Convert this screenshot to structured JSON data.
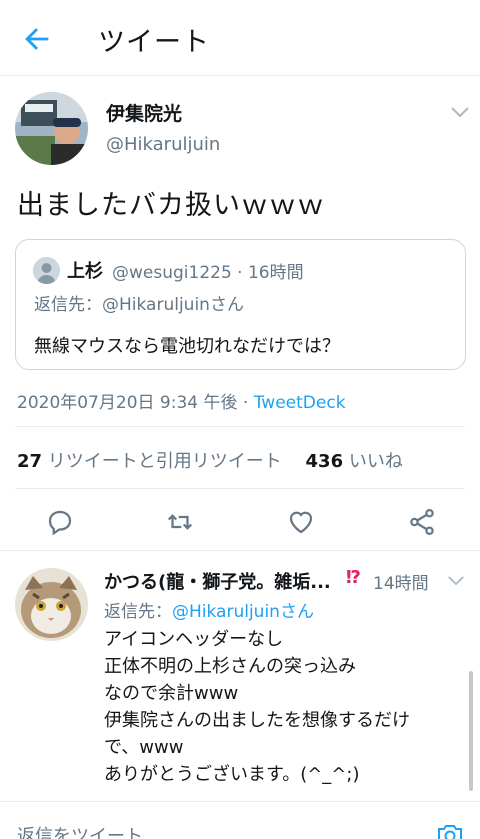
{
  "header": {
    "title": "ツイート",
    "back_icon": "back-arrow-icon"
  },
  "tweet": {
    "author_name": "伊集院光",
    "author_handle": "@Hikaruljuin",
    "text": "出ましたバカ扱いｗｗｗ",
    "quote": {
      "name": "上杉",
      "meta": "@wesugi1225 · 16時間",
      "reply_to": "返信先：@Hikaruljuinさん",
      "text": "無線マウスなら電池切れなだけでは？"
    },
    "timestamp": "2020年07月20日 9:34 午後 · ",
    "source": "TweetDeck",
    "stats": {
      "retweets_count": "27",
      "retweets_label": "リツイートと引用リツイート",
      "likes_count": "436",
      "likes_label": "いいね"
    }
  },
  "reply": {
    "name": "かつる(龍・獅子党。雑垢...",
    "badge": "⁉",
    "time": "14時間",
    "reply_prefix": "返信先：",
    "reply_mention": "@Hikaruljuinさん",
    "lines": [
      "アイコンヘッダーなし",
      "正体不明の上杉さんの突っ込み",
      "なので余計www",
      "伊集院さんの出ましたを想像するだけ",
      "で、www",
      "ありがとうございます。(^_^;)"
    ]
  },
  "compose": {
    "placeholder": "返信をツイート"
  },
  "colors": {
    "accent": "#1da1f2",
    "secondary_text": "#657786",
    "border": "#e6ecf0"
  }
}
